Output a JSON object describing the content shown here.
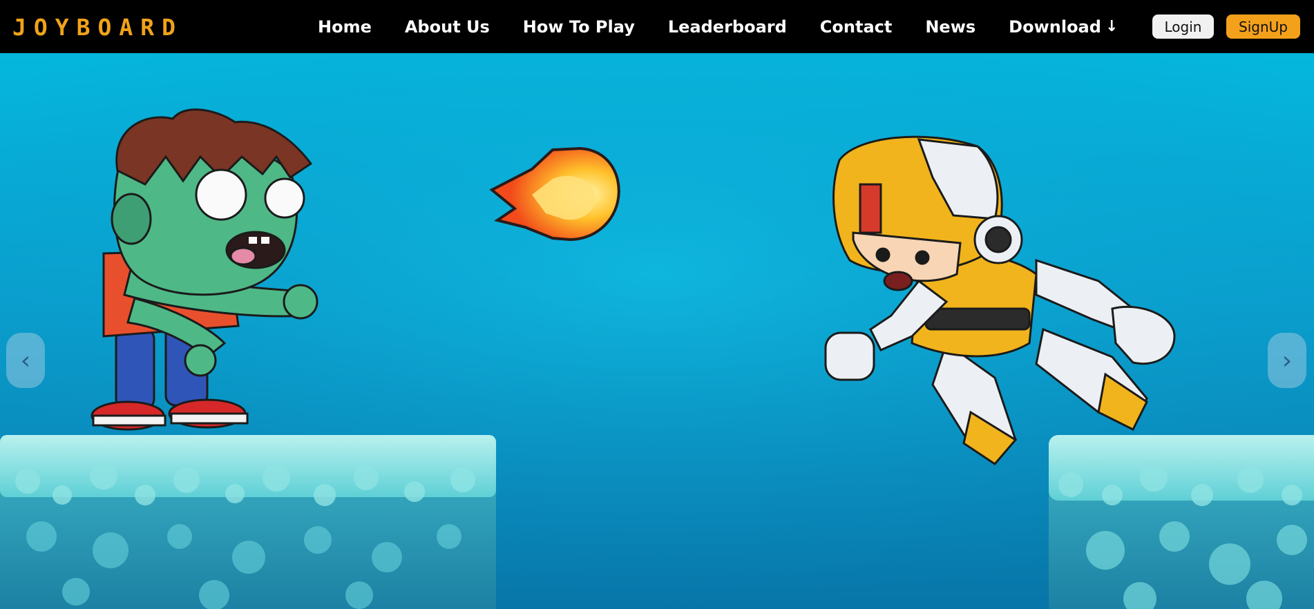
{
  "header": {
    "logo": "JOYBOARD",
    "nav": [
      {
        "label": "Home"
      },
      {
        "label": "About Us"
      },
      {
        "label": "How To Play"
      },
      {
        "label": "Leaderboard"
      },
      {
        "label": "Contact"
      },
      {
        "label": "News"
      },
      {
        "label": "Download"
      }
    ],
    "download_icon": "↓",
    "login_label": "Login",
    "signup_label": "SignUp"
  },
  "carousel": {
    "prev_glyph": "‹",
    "next_glyph": "›"
  },
  "colors": {
    "brand": "#f0a21a",
    "signup_bg": "#f3a01b",
    "login_bg": "#f1f1f1",
    "topbar_bg": "#000000",
    "sky_top": "#05b7dd",
    "sky_bottom": "#0875a8"
  },
  "icons": {
    "download": "download-arrow-icon",
    "prev": "chevron-left-icon",
    "next": "chevron-right-icon"
  }
}
